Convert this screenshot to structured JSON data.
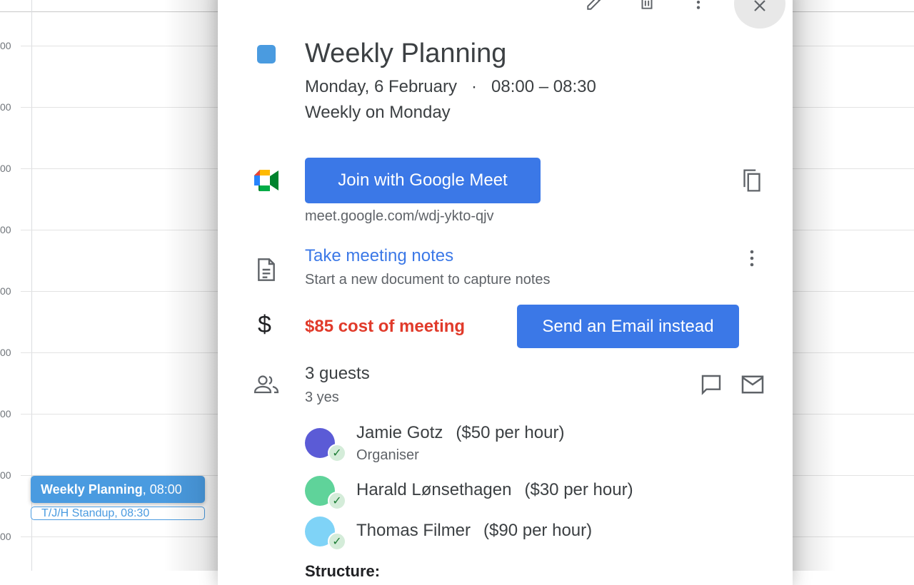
{
  "calendar": {
    "hour_labels": [
      "00",
      "00",
      "00",
      "00",
      "00",
      "00",
      "00",
      "00",
      "00"
    ],
    "events": [
      {
        "title": "Weekly Planning",
        "time": ", 08:00",
        "color": "#4a9be0"
      },
      {
        "title": "T/J/H Standup",
        "time": ", 08:30",
        "color": "#4a9be0"
      }
    ]
  },
  "dialog": {
    "toolbar": {
      "edit_icon": "pencil-icon",
      "delete_icon": "trash-icon",
      "more_icon": "more-vert-icon",
      "close_icon": "close-icon"
    },
    "event_color": "#4a9be0",
    "title": "Weekly Planning",
    "date": "Monday, 6 February",
    "separator": "·",
    "time": "08:00 – 08:30",
    "recurrence": "Weekly on Monday",
    "meet": {
      "button": "Join with Google Meet",
      "url": "meet.google.com/wdj-ykto-qjv"
    },
    "notes": {
      "link": "Take meeting notes",
      "subtitle": "Start a new document to capture notes"
    },
    "cost": {
      "label": "$85 cost of meeting",
      "button": "Send an Email instead",
      "color": "#e13a2a"
    },
    "guests": {
      "count": "3 guests",
      "summary": "3 yes",
      "list": [
        {
          "name": "Jamie Gotz",
          "rate": "($50 per hour)",
          "role": "Organiser",
          "avatar_color": "#5b5bd6"
        },
        {
          "name": "Harald Lønsethagen",
          "rate": "($30 per hour)",
          "role": "",
          "avatar_color": "#5fd39a"
        },
        {
          "name": "Thomas Filmer",
          "rate": "($90 per hour)",
          "role": "",
          "avatar_color": "#7fd3f7"
        }
      ]
    },
    "description_heading": "Structure:",
    "accent": "#3b78e7"
  }
}
